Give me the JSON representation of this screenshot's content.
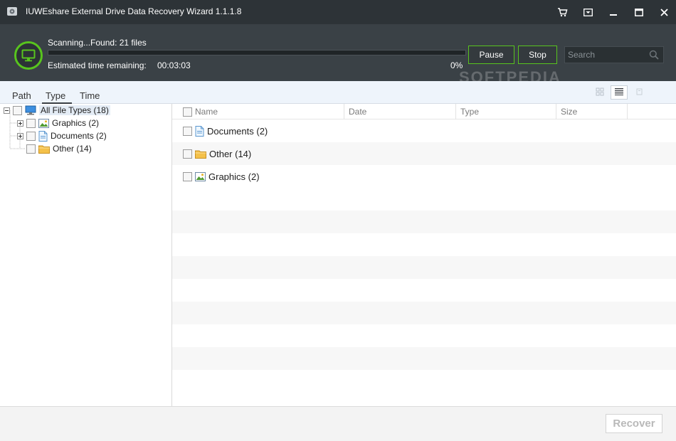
{
  "window": {
    "title": "IUWEshare External Drive Data Recovery Wizard 1.1.1.8",
    "icons": [
      "app-icon",
      "cart-icon",
      "menu-dropdown-icon",
      "minimize-icon",
      "maximize-icon",
      "close-icon"
    ]
  },
  "scan": {
    "status": "Scanning...Found: 21 files",
    "eta_label": "Estimated time remaining:",
    "eta_value": "00:03:03",
    "percent_text": "0%",
    "progress": 0.0,
    "pause_label": "Pause",
    "stop_label": "Stop",
    "search_placeholder": "Search"
  },
  "tabs": [
    {
      "label": "Path"
    },
    {
      "label": "Type",
      "selected": true
    },
    {
      "label": "Time"
    }
  ],
  "view_modes": [
    "thumbnail-view-icon",
    "list-view-icon",
    "details-view-icon"
  ],
  "tree": {
    "root": "All File Types (18)",
    "children": [
      {
        "label": "Graphics (2)",
        "icon": "image-icon",
        "expandable": true
      },
      {
        "label": "Documents (2)",
        "icon": "document-icon",
        "expandable": true
      },
      {
        "label": "Other (14)",
        "icon": "folder-icon",
        "expandable": false
      }
    ]
  },
  "list": {
    "columns": [
      "Name",
      "Date",
      "Type",
      "Size"
    ],
    "rows": [
      {
        "name": "Documents (2)",
        "icon": "document-icon"
      },
      {
        "name": "Other (14)",
        "icon": "folder-icon"
      },
      {
        "name": "Graphics (2)",
        "icon": "image-icon"
      }
    ]
  },
  "footer": {
    "recover_label": "Recover"
  },
  "watermark": "SOFTPEDIA",
  "colors": {
    "titlebar": "#2d3337",
    "scanpanel": "#3a4146",
    "accent_green": "#58c41e",
    "tabstrip": "#eef4fb"
  }
}
